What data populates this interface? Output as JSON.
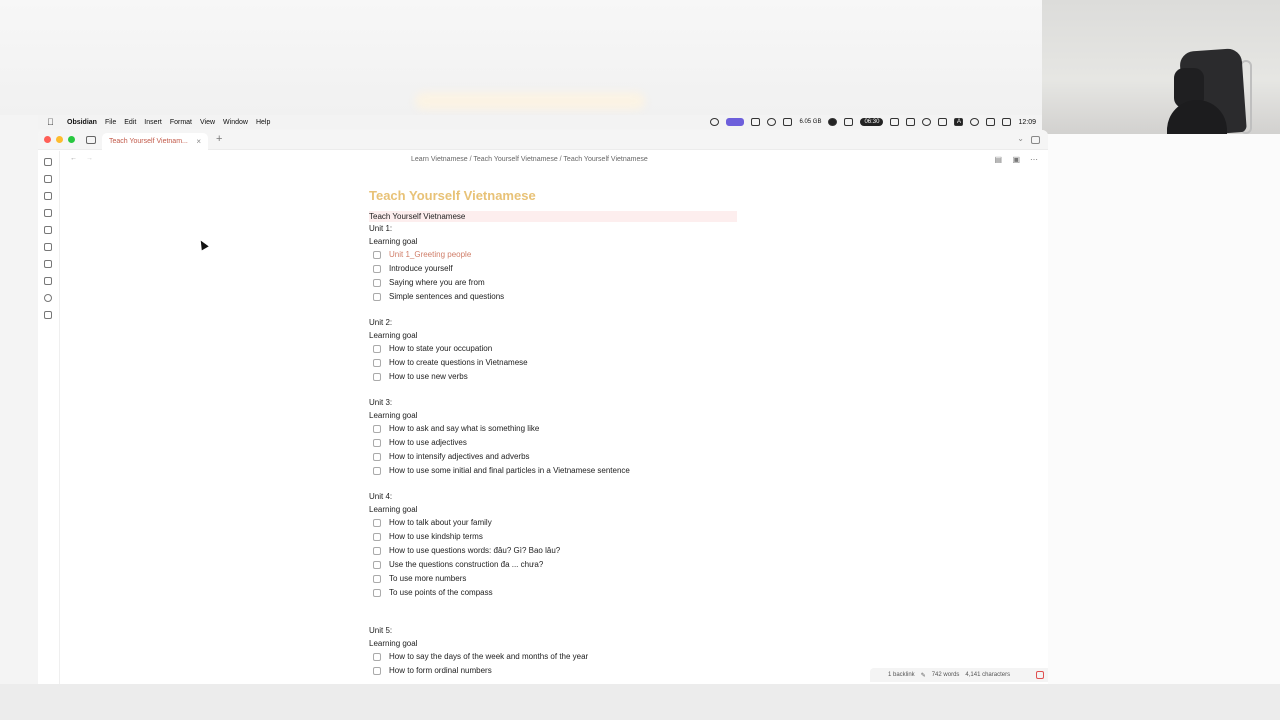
{
  "menubar": {
    "app": "Obsidian",
    "items": [
      "File",
      "Edit",
      "Insert",
      "Format",
      "View",
      "Window",
      "Help"
    ],
    "storage": "6.05 GB",
    "timer": "06:30",
    "input_source": "A",
    "clock": "12:09"
  },
  "tab": {
    "title": "Teach Yourself Vietnam...",
    "close": "×",
    "new": "+"
  },
  "nav": {
    "breadcrumb": "Learn Vietnamese / Teach Yourself Vietnamese / Teach Yourself Vietnamese"
  },
  "note": {
    "title": "Teach Yourself Vietnamese",
    "first_line": "Teach Yourself Vietnamese",
    "goal_label": "Learning goal",
    "units": [
      {
        "label": "Unit 1:",
        "tasks": [
          "Unit 1_Greeting people",
          "Introduce yourself",
          "Saying where you are from",
          "Simple sentences and questions"
        ]
      },
      {
        "label": "Unit 2:",
        "tasks": [
          "How to state your occupation",
          "How to create questions in Vietnamese",
          "How to use new verbs"
        ]
      },
      {
        "label": "Unit 3:",
        "tasks": [
          "How to ask and say what is something like",
          "How to use adjectives",
          "How to intensify adjectives and adverbs",
          "How to use some initial and final particles in a Vietnamese sentence"
        ]
      },
      {
        "label": "Unit 4:",
        "tasks": [
          "How to talk about your family",
          "How to use kindship terms",
          "How to use questions words: đâu? Gì? Bao lâu?",
          "Use the questions construction đa ... chưa?",
          "To use more numbers",
          "To use points of the compass"
        ]
      },
      {
        "label": "Unit 5:",
        "tasks": [
          "How to say the days of the week and months of the year",
          "How to form ordinal numbers"
        ]
      }
    ]
  },
  "status": {
    "backlinks": "1 backlink",
    "words": "742 words",
    "characters": "4,141 characters"
  }
}
